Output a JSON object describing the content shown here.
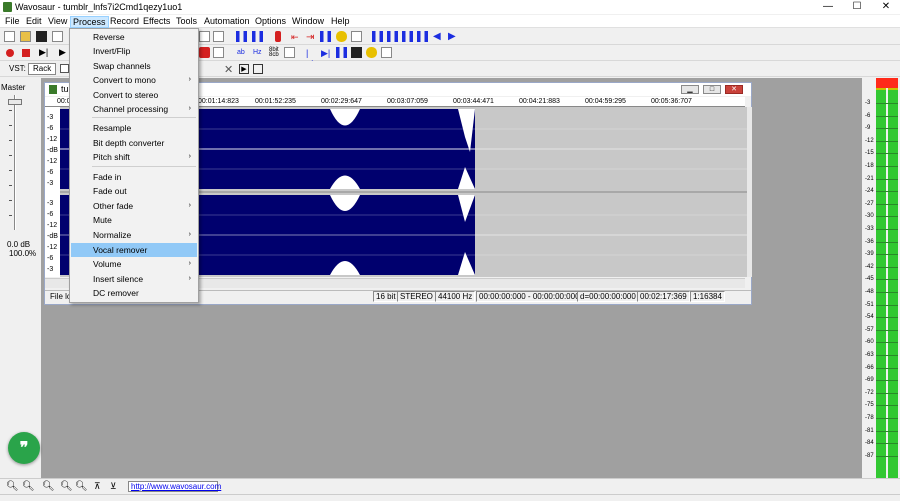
{
  "window": {
    "title": "Wavosaur - tumblr_lnfs7i2Cmd1qezy1uo1",
    "controls": {
      "minimize": "—",
      "maximize": "☐",
      "close": "✕"
    }
  },
  "menubar": [
    "File",
    "Edit",
    "View",
    "Process",
    "Record",
    "Effects",
    "Tools",
    "Automation",
    "Options",
    "Window",
    "Help"
  ],
  "active_menu": "Process",
  "process_menu": {
    "items": [
      {
        "label": "Reverse",
        "submenu": false
      },
      {
        "label": "Invert/Flip",
        "submenu": false
      },
      {
        "label": "Swap channels",
        "submenu": false
      },
      {
        "label": "Convert to mono",
        "submenu": true
      },
      {
        "label": "Convert to stereo",
        "submenu": false
      },
      {
        "label": "Channel processing",
        "submenu": true
      },
      {
        "label": "Resample",
        "submenu": false
      },
      {
        "label": "Bit depth converter",
        "submenu": false
      },
      {
        "label": "Pitch shift",
        "submenu": true
      },
      {
        "label": "Fade in",
        "submenu": false
      },
      {
        "label": "Fade out",
        "submenu": false
      },
      {
        "label": "Other fade",
        "submenu": true
      },
      {
        "label": "Mute",
        "submenu": false
      },
      {
        "label": "Normalize",
        "submenu": true
      },
      {
        "label": "Vocal remover",
        "submenu": false,
        "highlighted": true
      },
      {
        "label": "Volume",
        "submenu": true
      },
      {
        "label": "Insert silence",
        "submenu": true
      },
      {
        "label": "DC remover",
        "submenu": false
      }
    ]
  },
  "toolbar3": {
    "vst_label": "VST:",
    "rack_button": "Rack"
  },
  "master": {
    "label": "Master",
    "db": "0.0 dB",
    "percent": "100.0%",
    "level_fraction": 0.97
  },
  "child_window": {
    "title": "tu",
    "ruler": [
      "00:0",
      "00:01:14:823",
      "00:01:52:235",
      "00:02:29:647",
      "00:03:07:059",
      "00:03:44:471",
      "00:04:21:883",
      "00:04:59:295",
      "00:05:36:707"
    ],
    "axis_top": [
      "-3",
      "-6",
      "-12",
      "-dB",
      "-12",
      "-6",
      "-3"
    ],
    "axis_bottom": [
      "-3",
      "-6",
      "-12",
      "-dB",
      "-12",
      "-6",
      "-3"
    ],
    "status": {
      "file": "File lo",
      "bits": "16 bit",
      "channels": "STEREO",
      "rate": "44100 Hz",
      "selection": "00:00:00:000 - 00:00:00:000",
      "duration_sel": "d=00:00:00:000",
      "length": "00:02:17:369",
      "zoom": "1:16384"
    },
    "waveform_color": "#00006e",
    "background_color": "#c8c8c8"
  },
  "vu_meter": {
    "labels": [
      "-3",
      "-6",
      "-9",
      "-12",
      "-15",
      "-18",
      "-21",
      "-24",
      "-27",
      "-30",
      "-33",
      "-36",
      "-39",
      "-42",
      "-45",
      "-48",
      "-51",
      "-54",
      "-57",
      "-60",
      "-63",
      "-66",
      "-69",
      "-72",
      "-75",
      "-78",
      "-81",
      "-84",
      "-87"
    ],
    "peak_color": "#ff2a1a",
    "level_color": "#32c832"
  },
  "bottom": {
    "url": "http://www.wavosaur.com"
  },
  "chat_icon": "quote-icon"
}
